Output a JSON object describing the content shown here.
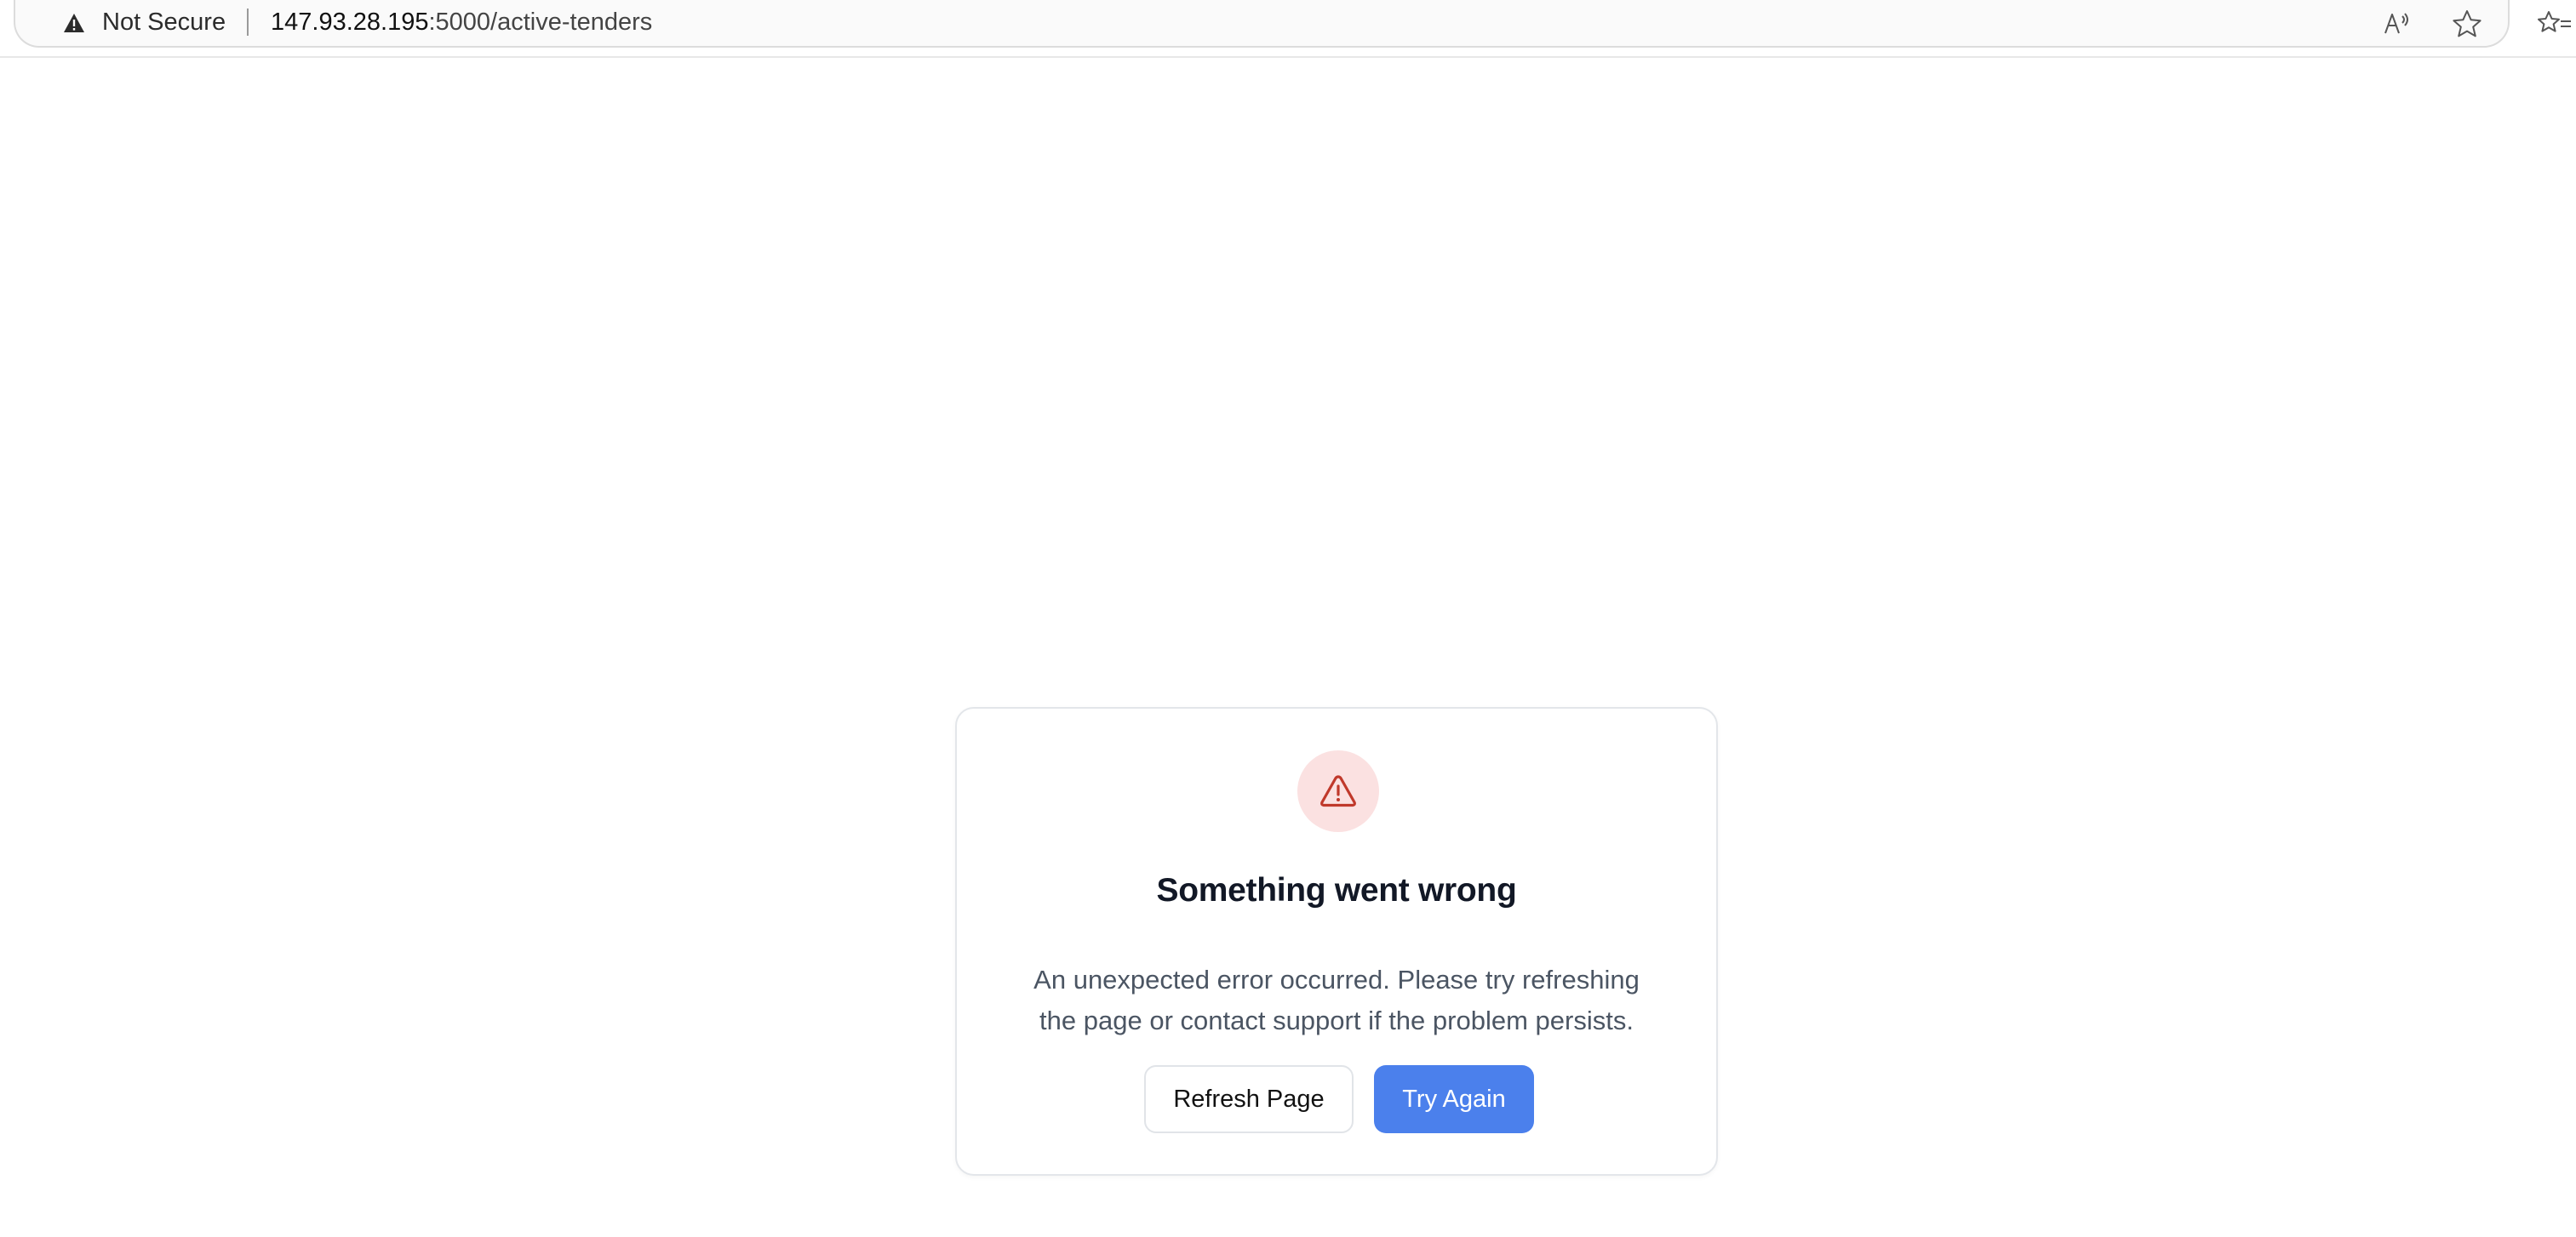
{
  "browser": {
    "security_label": "Not Secure",
    "url_host": "147.93.28.195",
    "url_rest": ":5000/active-tenders",
    "icons": {
      "security": "warning-triangle-icon",
      "read_aloud": "read-aloud-icon",
      "favorite": "star-icon",
      "favorites_list": "favorites-list-icon"
    }
  },
  "error": {
    "icon": "warning-triangle-icon",
    "title": "Something went wrong",
    "message_line1": "An unexpected error occurred. Please try refreshing",
    "message_line2": "the page or contact support if the problem persists.",
    "refresh_label": "Refresh Page",
    "try_again_label": "Try Again"
  },
  "colors": {
    "accent": "#4b80ec",
    "error_icon": "#c0392b",
    "error_icon_bg": "#fbe1e1",
    "title": "#121826",
    "message": "#4b5563"
  }
}
